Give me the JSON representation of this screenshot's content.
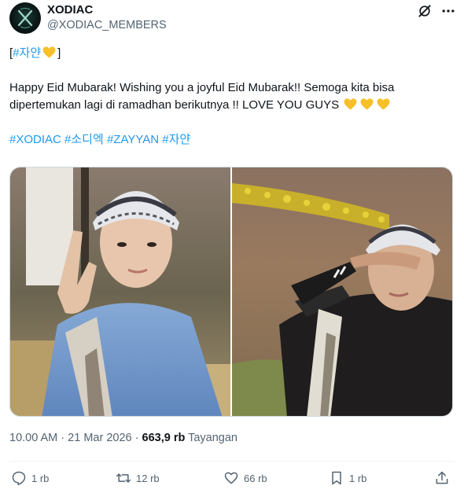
{
  "author": {
    "display_name": "XODIAC",
    "handle": "@XODIAC_MEMBERS",
    "avatar_icon": "xodiac-logo"
  },
  "tweet": {
    "line1_prefix": "[",
    "line1_tag": "#자얀",
    "line1_suffix": "]",
    "line2": "Happy Eid Mubarak! Wishing you a joyful Eid Mubarak!! Semoga kita bisa",
    "line3": "dipertemukan lagi di ramadhan berikutnya !! LOVE YOU GUYS",
    "hashtags": [
      "#XODIAC",
      "#소디엑",
      "#ZAYYAN",
      "#자얀"
    ],
    "heart_emoji_color": "#f7c02a"
  },
  "media": {
    "photo1_desc": "selfie-peace-sign",
    "photo2_desc": "selfie-shading-eyes"
  },
  "meta": {
    "time": "10.00 AM",
    "separator": "·",
    "date": "21 Mar 2026",
    "views_count": "663,9 rb",
    "views_label": "Tayangan"
  },
  "actions": {
    "reply_count": "1 rb",
    "retweet_count": "12 rb",
    "like_count": "66 rb",
    "bookmark_count": "1 rb"
  },
  "colors": {
    "link": "#1d9bf0",
    "secondary_text": "#536471",
    "primary_text": "#0f1419"
  }
}
